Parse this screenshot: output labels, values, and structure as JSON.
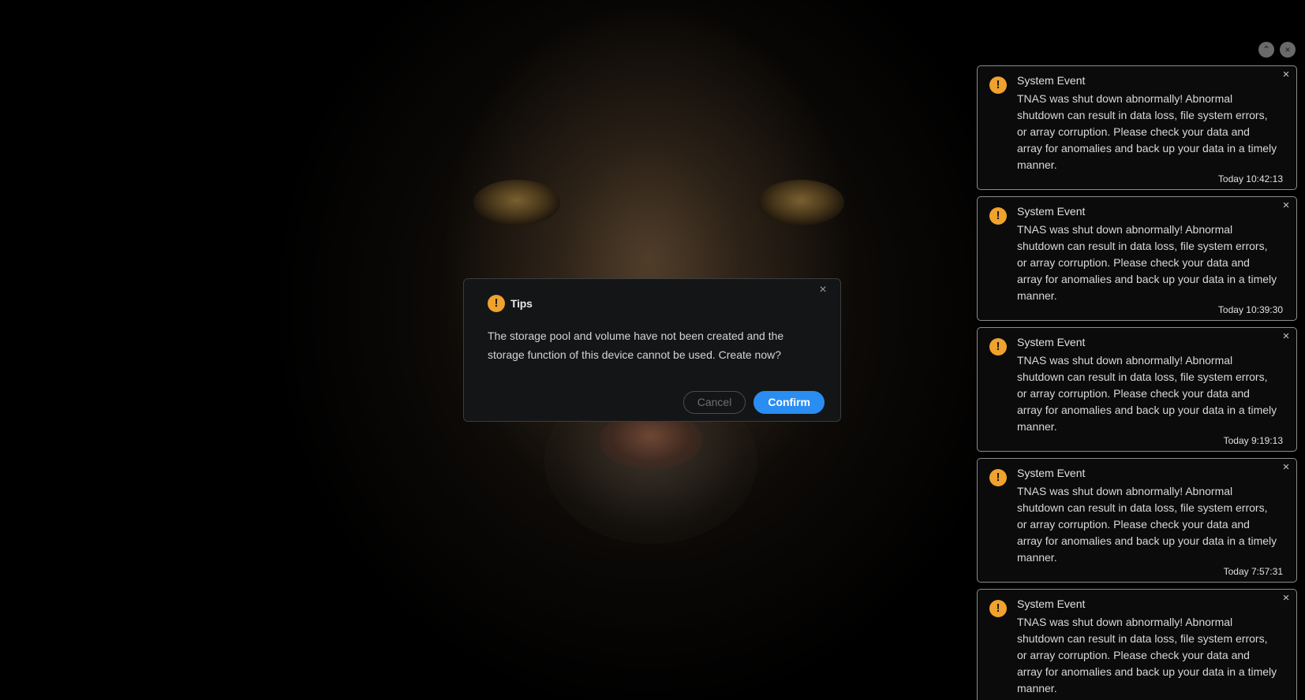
{
  "dialog": {
    "icon": "warning-icon",
    "title": "Tips",
    "message": "The storage pool and volume have not been created and the storage function of this device cannot be used. Create now?",
    "close_label": "×",
    "cancel_label": "Cancel",
    "confirm_label": "Confirm",
    "accent_color": "#2a8df2",
    "warning_color": "#f0a22e"
  },
  "panel_controls": {
    "collapse_icon": "chevron-up-icon",
    "collapse_label": "⌃",
    "close_all_icon": "close-icon",
    "close_all_label": "×"
  },
  "notifications": [
    {
      "title": "System Event",
      "body": "TNAS was shut down abnormally! Abnormal shutdown can result in data loss, file system errors, or array corruption. Please check your data and array for anomalies and back up your data in a timely manner.",
      "time": "Today 10:42:13",
      "close_label": "×"
    },
    {
      "title": "System Event",
      "body": "TNAS was shut down abnormally! Abnormal shutdown can result in data loss, file system errors, or array corruption. Please check your data and array for anomalies and back up your data in a timely manner.",
      "time": "Today 10:39:30",
      "close_label": "×"
    },
    {
      "title": "System Event",
      "body": "TNAS was shut down abnormally! Abnormal shutdown can result in data loss, file system errors, or array corruption. Please check your data and array for anomalies and back up your data in a timely manner.",
      "time": "Today 9:19:13",
      "close_label": "×"
    },
    {
      "title": "System Event",
      "body": "TNAS was shut down abnormally! Abnormal shutdown can result in data loss, file system errors, or array corruption. Please check your data and array for anomalies and back up your data in a timely manner.",
      "time": "Today 7:57:31",
      "close_label": "×"
    },
    {
      "title": "System Event",
      "body": "TNAS was shut down abnormally! Abnormal shutdown can result in data loss, file system errors, or array corruption. Please check your data and array for anomalies and back up your data in a timely manner.",
      "close_label": "×"
    }
  ]
}
